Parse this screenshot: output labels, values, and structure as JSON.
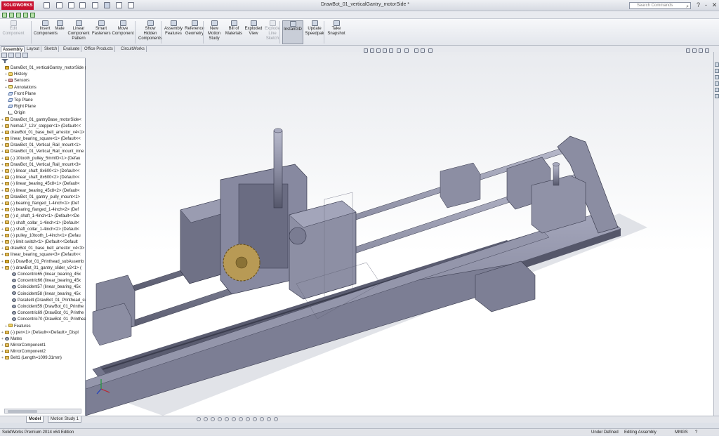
{
  "window": {
    "title": "DrawBot_01_verticalGantry_motorSide *",
    "brand": "SOLIDWORKS",
    "search_placeholder": "Search Commands"
  },
  "ribbon": [
    {
      "label": "Edit\nComponent",
      "dim": true
    },
    {
      "label": "Insert\nComponents"
    },
    {
      "label": "Mate"
    },
    {
      "label": "Linear\nComponent\nPattern"
    },
    {
      "label": "Smart\nFasteners"
    },
    {
      "label": "Move\nComponent"
    },
    {
      "label": "Show\nHidden\nComponents"
    },
    {
      "label": "Assembly\nFeatures"
    },
    {
      "label": "Reference\nGeometry"
    },
    {
      "label": "New\nMotion\nStudy"
    },
    {
      "label": "Bill of\nMaterials"
    },
    {
      "label": "Exploded\nView"
    },
    {
      "label": "Explode\nLine\nSketch",
      "dim": true
    },
    {
      "label": "Instant3D",
      "active": true
    },
    {
      "label": "Update\nSpeedpak"
    },
    {
      "label": "Take\nSnapshot"
    }
  ],
  "command_tabs": [
    "Assembly",
    "Layout",
    "Sketch",
    "Evaluate",
    "Office Products",
    "CircuitWorks"
  ],
  "tree": [
    {
      "label": "DarwBot_01_verticalGantry_motorSide  (",
      "icon": "asm",
      "indent": 0
    },
    {
      "label": "History",
      "icon": "folder",
      "indent": 1
    },
    {
      "label": "Sensors",
      "icon": "sensor",
      "indent": 1
    },
    {
      "label": "Annotations",
      "icon": "annot",
      "indent": 1
    },
    {
      "label": "Front Plane",
      "icon": "plane",
      "indent": 1
    },
    {
      "label": "Top Plane",
      "icon": "plane",
      "indent": 1
    },
    {
      "label": "Right Plane",
      "icon": "plane",
      "indent": 1
    },
    {
      "label": "Origin",
      "icon": "origin",
      "indent": 1
    },
    {
      "label": "DrawBot_01_gantryBase_motorSide<",
      "icon": "part",
      "indent": 0
    },
    {
      "label": "Nema17_12V_stepper<1> (Default<<",
      "icon": "part",
      "indent": 0
    },
    {
      "label": "drawBot_01_base_belt_arrestor_v4<1>",
      "icon": "part",
      "indent": 0
    },
    {
      "label": "linear_bearing_square<1> (Default<<",
      "icon": "part",
      "indent": 0
    },
    {
      "label": "DrawBot_01_Vertical_Rail_mount<1>",
      "icon": "part",
      "indent": 0
    },
    {
      "label": "DrawBot_01_Vertical_Rail_mount_inne",
      "icon": "part",
      "indent": 0
    },
    {
      "label": "(-) 10tooth_pulley_5mmID<1> (Defau",
      "icon": "part",
      "indent": 0
    },
    {
      "label": "DrawBot_01_Vertical_Rail_mount<3>",
      "icon": "part",
      "indent": 0
    },
    {
      "label": "(-) linear_shaft_8x600<1> (Default<<",
      "icon": "part",
      "indent": 0
    },
    {
      "label": "(-) linear_shaft_8x600<2> (Default<<",
      "icon": "part",
      "indent": 0
    },
    {
      "label": "(-) linear_bearing_45x8<1> (Default<",
      "icon": "part",
      "indent": 0
    },
    {
      "label": "(-) linear_bearing_45x8<2> (Default<",
      "icon": "part",
      "indent": 0
    },
    {
      "label": "DrawBot_01_gantry_pully_mount<1>",
      "icon": "part",
      "indent": 0
    },
    {
      "label": "(-) bearing_flanged_1-4inch<1> (Def",
      "icon": "part",
      "indent": 0
    },
    {
      "label": "(-) bearing_flanged_1-4inch<2> (Def",
      "icon": "part",
      "indent": 0
    },
    {
      "label": "(-) d_shaft_1-4inch<1> (Default<<De",
      "icon": "part",
      "indent": 0
    },
    {
      "label": "(-) shaft_collar_1-4inch<1> (Default<",
      "icon": "part",
      "indent": 0
    },
    {
      "label": "(-) shaft_collar_1-4inch<2> (Default<",
      "icon": "part",
      "indent": 0
    },
    {
      "label": "(-) pulley_10tooth_1-4inch<1> (Defau",
      "icon": "part",
      "indent": 0
    },
    {
      "label": "(-) limit switch<1> (Default<<Default",
      "icon": "part",
      "indent": 0
    },
    {
      "label": "drawBot_01_base_belt_arrestor_v4<3>",
      "icon": "part",
      "indent": 0
    },
    {
      "label": "linear_bearing_square<3> (Default<<",
      "icon": "part",
      "indent": 0
    },
    {
      "label": "(-) DrawBot_01_Printhead_subAssemb",
      "icon": "asm",
      "indent": 0
    },
    {
      "label": "(-) drawBot_01_gantry_slider_v2<1> (",
      "icon": "part",
      "indent": 0
    },
    {
      "label": "Concentric65 (linear_bearing_45x",
      "icon": "mate",
      "indent": 2
    },
    {
      "label": "Concentric66 (linear_bearing_45x",
      "icon": "mate",
      "indent": 2
    },
    {
      "label": "Coincident57 (linear_bearing_45x",
      "icon": "mate",
      "indent": 2
    },
    {
      "label": "Coincident58 (linear_bearing_45x",
      "icon": "mate",
      "indent": 2
    },
    {
      "label": "Parallel4 (DrawBot_01_Printhead_su",
      "icon": "mate",
      "indent": 2
    },
    {
      "label": "Coincident59 (DrawBot_01_Printhe",
      "icon": "mate",
      "indent": 2
    },
    {
      "label": "Concentric69 (DrawBot_01_Printhe",
      "icon": "mate",
      "indent": 2
    },
    {
      "label": "Concentric70 (DrawBot_01_Printhea",
      "icon": "mate",
      "indent": 2
    },
    {
      "label": "Features",
      "icon": "folder",
      "indent": 1
    },
    {
      "label": "(-) pen<1> (Default<<Default>_Displ",
      "icon": "part",
      "indent": 0
    },
    {
      "label": "Mates",
      "icon": "mate",
      "indent": 0
    },
    {
      "label": "MirrorComponent1",
      "icon": "part",
      "indent": 0
    },
    {
      "label": "MirrorComponent2",
      "icon": "part",
      "indent": 0
    },
    {
      "label": "Belt1 (Length=1099.31mm)",
      "icon": "part",
      "indent": 0
    }
  ],
  "bottom_tabs": [
    "Model",
    "Motion Study 1"
  ],
  "status": {
    "edition": "SolidWorks Premium 2014 x64 Edition",
    "state": "Under Defined",
    "mode": "Editing Assembly",
    "units": "MMGS"
  },
  "colors": {
    "model_body": "#8e90a6",
    "model_dark": "#55576a",
    "gear": "#b89a55",
    "accent": "#c8102e"
  }
}
